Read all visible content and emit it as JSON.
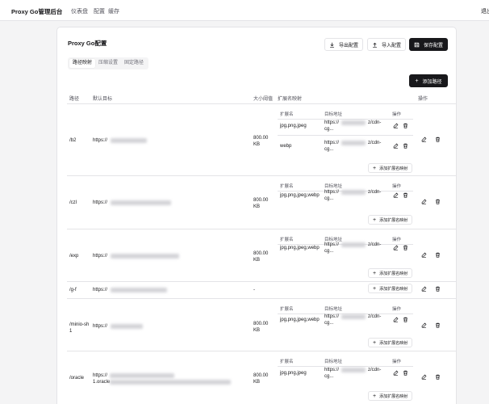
{
  "topbar": {
    "brand": "Proxy Go管理后台",
    "nav": [
      "仪表盘",
      "配置",
      "缓存"
    ],
    "right": "退出"
  },
  "card": {
    "title": "Proxy Go配置",
    "buttons": {
      "export": "导出配置",
      "import": "导入配置",
      "save": "保存配置"
    },
    "tabs": [
      "路径映射",
      "压缩设置",
      "固定路径"
    ],
    "add_path": "添加路径",
    "headers": {
      "path": "路径",
      "default_target": "默认目标",
      "size_threshold": "大小阈值",
      "ext_map": "扩展名映射",
      "actions": "操作"
    },
    "sub_headers": {
      "ext": "扩展名",
      "target": "目标地址",
      "actions": "操作"
    },
    "add_ext_label": "添加扩展名映射",
    "rows": [
      {
        "path": "/b2",
        "target": "https://",
        "size": "800.00 KB",
        "ext": [
          {
            "name": "jpg,png,jpeg",
            "t1": "https://",
            "t2": "z/cdn-",
            "t3": "cg..."
          },
          {
            "name": "webp",
            "t1": "https://",
            "t2": "z/cdn-",
            "t3": "cg..."
          }
        ]
      },
      {
        "path": "/czl",
        "target": "https://",
        "size": "800.00 KB",
        "ext": [
          {
            "name": "jpg,png,jpeg,webp",
            "t1": "https://",
            "t2": "z/cdn-",
            "t3": "cg..."
          }
        ]
      },
      {
        "path": "/exp",
        "target": "https://",
        "size": "800.00 KB",
        "ext": [
          {
            "name": "jpg,png,jpeg,webp",
            "t1": "https://",
            "t2": "z/cdn-",
            "t3": "cg..."
          }
        ]
      },
      {
        "path": "/g-f",
        "target": "https://",
        "size": "-",
        "ext": []
      },
      {
        "path": "/minio-sh1",
        "target": "https://",
        "size": "800.00 KB",
        "ext": [
          {
            "name": "jpg,png,jpeg,webp",
            "t1": "https://",
            "t2": "z/cdn-",
            "t3": "cg..."
          }
        ]
      },
      {
        "path": "/oracle",
        "target": "https://",
        "target2": "1.oracle",
        "size": "800.00 KB",
        "ext": [
          {
            "name": "jpg,png,jpeg",
            "t1": "https://",
            "t2": "z/cdn-",
            "t3": "cg..."
          }
        ]
      }
    ]
  }
}
